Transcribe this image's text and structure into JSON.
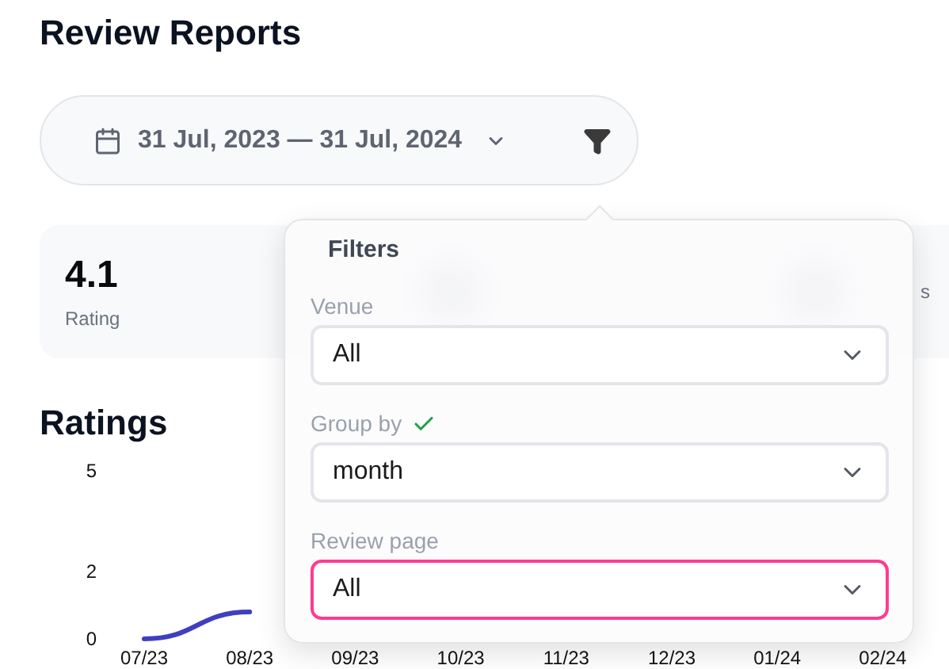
{
  "page": {
    "title": "Review Reports"
  },
  "date_range": {
    "label": "31 Jul, 2023 — 31 Jul, 2024"
  },
  "stats": [
    {
      "value": "4.1",
      "label": "Rating"
    },
    {
      "label": "s"
    }
  ],
  "filters": {
    "title": "Filters",
    "fields": [
      {
        "label": "Venue",
        "value": "All",
        "valid": false,
        "focused": false
      },
      {
        "label": "Group by",
        "value": "month",
        "valid": true,
        "focused": false
      },
      {
        "label": "Review page",
        "value": "All",
        "valid": false,
        "focused": true
      }
    ]
  },
  "ratings": {
    "title": "Ratings",
    "chart_data": {
      "type": "line",
      "categories": [
        "07/23",
        "08/23",
        "09/23",
        "10/23",
        "11/23",
        "12/23",
        "01/24",
        "02/24"
      ],
      "series": [
        {
          "color": "#3f3fbf",
          "values": [
            0,
            0.8,
            null,
            null,
            null,
            null,
            null,
            null
          ]
        }
      ],
      "ylim": [
        0,
        5
      ],
      "yticks": [
        0,
        2,
        5
      ]
    }
  }
}
